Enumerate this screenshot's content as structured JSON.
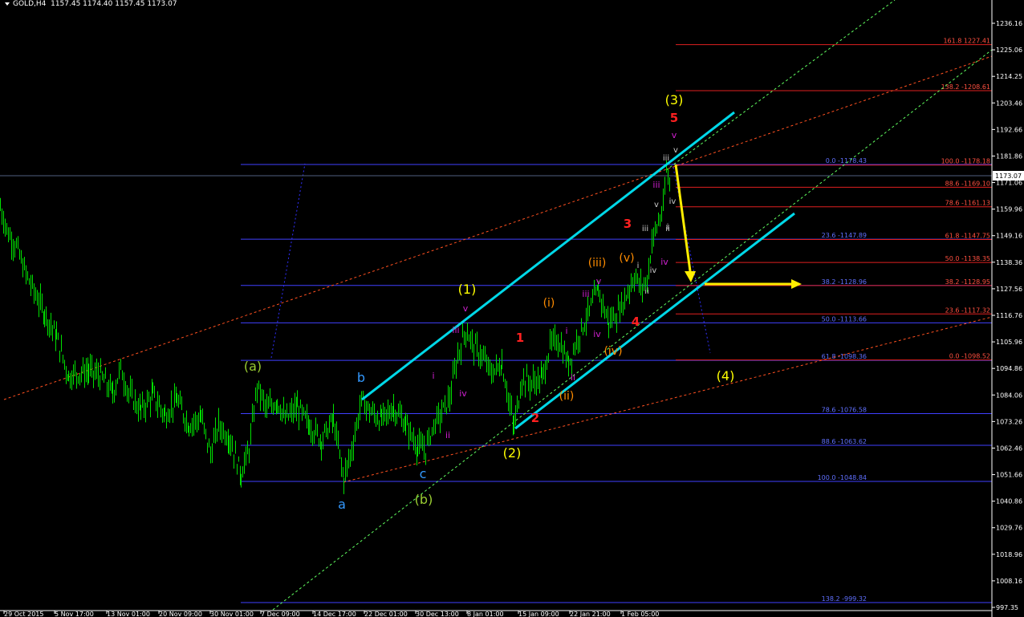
{
  "header": {
    "symbol": "GOLD,H4",
    "ohlc": "1157.45 1174.40 1157.45 1173.07"
  },
  "current_price": "1173.07",
  "colors": {
    "background": "#000000",
    "candles": "#00e000",
    "channel": "#00d8e8",
    "fib_blue": "#4040ff",
    "fib_red": "#ff3030",
    "arrow": "#ffee00"
  },
  "chart_data": {
    "type": "line",
    "title": "",
    "symbol": "GOLD",
    "timeframe": "H4",
    "ylim": [
      993,
      1244
    ],
    "y_ticks": [
      "1236.16",
      "1225.06",
      "1214.25",
      "1203.46",
      "1192.66",
      "1181.86",
      "1171.06",
      "1159.96",
      "1149.16",
      "1138.36",
      "1127.56",
      "1116.76",
      "1105.96",
      "1094.86",
      "1084.06",
      "1073.26",
      "1062.46",
      "1051.66",
      "1040.86",
      "1029.76",
      "1018.96",
      "1008.16",
      "997.35"
    ],
    "x_ticks": [
      "29 Oct 2015",
      "5 Nov 17:00",
      "13 Nov 01:00",
      "20 Nov 09:00",
      "30 Nov 01:00",
      "7 Dec 09:00",
      "14 Dec 17:00",
      "22 Dec 01:00",
      "30 Dec 13:00",
      "8 Jan 01:00",
      "15 Jan 09:00",
      "22 Jan 21:00",
      "1 Feb 05:00"
    ],
    "price_path": [
      [
        0,
        1161
      ],
      [
        10,
        1150
      ],
      [
        20,
        1145
      ],
      [
        30,
        1135
      ],
      [
        40,
        1128
      ],
      [
        55,
        1118
      ],
      [
        70,
        1108
      ],
      [
        85,
        1092
      ],
      [
        95,
        1093
      ],
      [
        110,
        1094
      ],
      [
        125,
        1092
      ],
      [
        140,
        1085
      ],
      [
        150,
        1095
      ],
      [
        160,
        1085
      ],
      [
        175,
        1078
      ],
      [
        190,
        1084
      ],
      [
        205,
        1076
      ],
      [
        220,
        1082
      ],
      [
        235,
        1072
      ],
      [
        250,
        1075
      ],
      [
        262,
        1060
      ],
      [
        272,
        1072
      ],
      [
        285,
        1067
      ],
      [
        300,
        1052
      ],
      [
        310,
        1062
      ],
      [
        320,
        1088
      ],
      [
        332,
        1078
      ],
      [
        345,
        1082
      ],
      [
        355,
        1074
      ],
      [
        370,
        1079
      ],
      [
        385,
        1072
      ],
      [
        400,
        1066
      ],
      [
        415,
        1074
      ],
      [
        428,
        1050
      ],
      [
        438,
        1062
      ],
      [
        450,
        1082
      ],
      [
        462,
        1077
      ],
      [
        475,
        1074
      ],
      [
        490,
        1079
      ],
      [
        505,
        1072
      ],
      [
        520,
        1063
      ],
      [
        530,
        1062
      ],
      [
        540,
        1072
      ],
      [
        552,
        1078
      ],
      [
        560,
        1083
      ],
      [
        570,
        1100
      ],
      [
        580,
        1111
      ],
      [
        590,
        1104
      ],
      [
        600,
        1100
      ],
      [
        612,
        1093
      ],
      [
        625,
        1097
      ],
      [
        640,
        1071
      ],
      [
        650,
        1091
      ],
      [
        662,
        1089
      ],
      [
        675,
        1091
      ],
      [
        685,
        1104
      ],
      [
        695,
        1107
      ],
      [
        708,
        1097
      ],
      [
        720,
        1108
      ],
      [
        732,
        1117
      ],
      [
        745,
        1127
      ],
      [
        758,
        1114
      ],
      [
        770,
        1118
      ],
      [
        780,
        1125
      ],
      [
        790,
        1133
      ],
      [
        798,
        1128
      ],
      [
        806,
        1131
      ],
      [
        812,
        1147
      ],
      [
        818,
        1153
      ],
      [
        826,
        1160
      ],
      [
        830,
        1176
      ],
      [
        836,
        1168
      ]
    ],
    "waves": [
      {
        "label": "(a)",
        "color": "#9acd32"
      },
      {
        "label": "(b)",
        "color": "#9acd32"
      },
      {
        "label": "a",
        "color": "#3399ff"
      },
      {
        "label": "b",
        "color": "#3399ff"
      },
      {
        "label": "c",
        "color": "#3399ff"
      },
      {
        "label": "(1)",
        "color": "#ffff00"
      },
      {
        "label": "(2)",
        "color": "#ffff00"
      },
      {
        "label": "(3)",
        "color": "#ffff00"
      },
      {
        "label": "(4)",
        "color": "#ffff00"
      },
      {
        "label": "1",
        "color": "#ff2020"
      },
      {
        "label": "2",
        "color": "#ff2020"
      },
      {
        "label": "3",
        "color": "#ff2020"
      },
      {
        "label": "4",
        "color": "#ff2020"
      },
      {
        "label": "5",
        "color": "#ff2020"
      },
      {
        "label": "(i)",
        "color": "#ff8c00"
      },
      {
        "label": "(ii)",
        "color": "#ff8c00"
      },
      {
        "label": "(iii)",
        "color": "#ff8c00"
      },
      {
        "label": "(iv)",
        "color": "#ff8c00"
      },
      {
        "label": "(v)",
        "color": "#ff8c00"
      },
      {
        "label": "i",
        "color": "#d020d0"
      },
      {
        "label": "ii",
        "color": "#d020d0"
      },
      {
        "label": "iii",
        "color": "#d020d0"
      },
      {
        "label": "iv",
        "color": "#d020d0"
      },
      {
        "label": "v",
        "color": "#d020d0"
      },
      {
        "label": "i",
        "color": "#d020d0"
      },
      {
        "label": "ii",
        "color": "#d020d0"
      },
      {
        "label": "iii",
        "color": "#d020d0"
      },
      {
        "label": "iv",
        "color": "#d020d0"
      },
      {
        "label": "v",
        "color": "#d020d0"
      },
      {
        "label": "iii",
        "color": "#d020d0"
      },
      {
        "label": "iv",
        "color": "#d020d0"
      },
      {
        "label": "v",
        "color": "#d020d0"
      },
      {
        "label": "i",
        "color": "#cccccc"
      },
      {
        "label": "ii",
        "color": "#cccccc"
      },
      {
        "label": "iii",
        "color": "#cccccc"
      },
      {
        "label": "iv",
        "color": "#cccccc"
      },
      {
        "label": "v",
        "color": "#cccccc"
      },
      {
        "label": "i",
        "color": "#cccccc"
      },
      {
        "label": "ii",
        "color": "#cccccc"
      },
      {
        "label": "iii",
        "color": "#cccccc"
      },
      {
        "label": "iv",
        "color": "#cccccc"
      },
      {
        "label": "v",
        "color": "#cccccc"
      }
    ],
    "fib_blue": [
      {
        "label": "0.0 -1178.43",
        "value": 1178.43
      },
      {
        "label": "23.6 -1147.89",
        "value": 1147.89
      },
      {
        "label": "38.2 -1128.96",
        "value": 1128.96
      },
      {
        "label": "50.0 -1113.66",
        "value": 1113.66
      },
      {
        "label": "61.8 -1098.36",
        "value": 1098.36
      },
      {
        "label": "78.6 -1076.58",
        "value": 1076.58
      },
      {
        "label": "88.6 -1063.62",
        "value": 1063.62
      },
      {
        "label": "100.0 -1048.84",
        "value": 1048.84
      },
      {
        "label": "138.2 -999.32",
        "value": 999.32
      }
    ],
    "fib_red": [
      {
        "label": "161.8 1227.41",
        "value": 1227.41
      },
      {
        "label": "138.2 -1208.61",
        "value": 1208.61
      },
      {
        "label": "100.0 -1178.18",
        "value": 1178.18
      },
      {
        "label": "88.6 -1169.10",
        "value": 1169.1
      },
      {
        "label": "78.6 -1161.13",
        "value": 1161.13
      },
      {
        "label": "61.8 -1147.75",
        "value": 1147.75
      },
      {
        "label": "50.0 -1138.35",
        "value": 1138.35
      },
      {
        "label": "38.2 -1128.95",
        "value": 1128.95
      },
      {
        "label": "23.6 -1117.32",
        "value": 1117.32
      },
      {
        "label": "0.0 -1098.52",
        "value": 1098.52
      }
    ]
  }
}
